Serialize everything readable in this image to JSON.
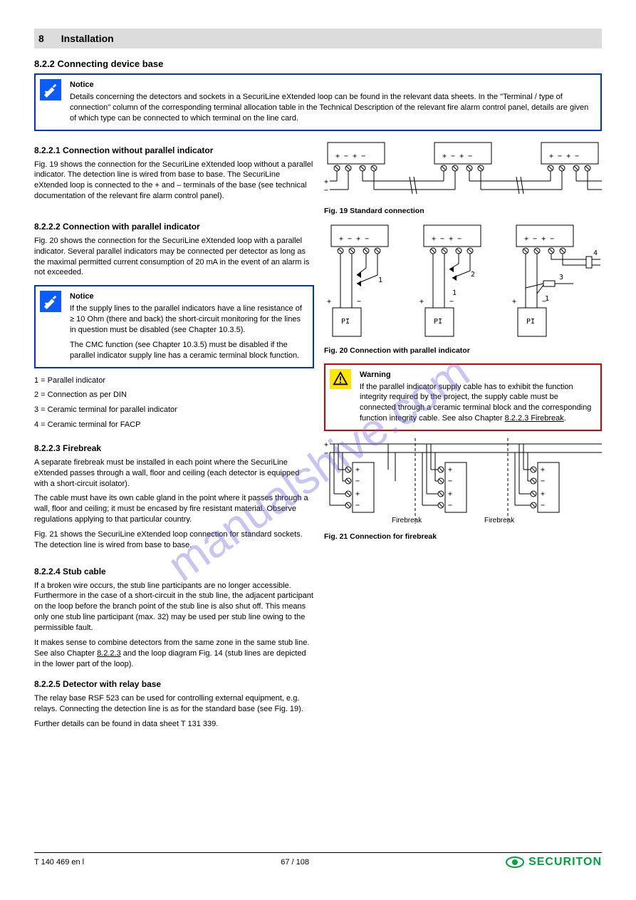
{
  "header": {
    "section_number": "8",
    "section_title": "Installation"
  },
  "section_top": "8.2.2   Connecting device base",
  "top_note": {
    "title": "Notice",
    "body": "Details concerning the detectors and sockets in a SecuriLine eXtended loop can be found in the relevant data sheets. In the \"Terminal / type of connection\" column of the corresponding terminal allocation table in the Technical Description of the relevant fire alarm control panel, details are given of which type can be connected to which terminal on the line card."
  },
  "conn_heading": "8.2.2.1  Connection without parallel indicator",
  "conn_para": "Fig. 19 shows the connection for the SecuriLine eXtended loop without a parallel indicator. The detection line is wired from base to base. The SecuriLine eXtended loop is connected to the + and – terminals of the base (see technical documentation of the relevant fire alarm control panel).",
  "fig19_caption": "Fig. 19  Standard connection",
  "parallel_heading": "8.2.2.2  Connection with parallel indicator",
  "parallel_para": "Fig. 20 shows the connection for the SecuriLine eXtended loop with a parallel indicator. Several parallel indicators may be connected per detector as long as the maximal permitted current consumption of 20 mA in the event of an alarm is not exceeded.",
  "small_note": {
    "title": "Notice",
    "body_lines": [
      "If the supply lines to the parallel indicators have a line resistance of ≥ 10 Ohm (there and back) the short-circuit monitoring for the lines in question must be disabled (see Chapter 10.3.5).",
      "The CMC function (see Chapter 10.3.5) must be disabled if the parallel indicator supply line has a ceramic terminal block function."
    ]
  },
  "fig20_legend_lines": [
    "1 = Parallel indicator",
    "2 = Connection as per DIN",
    "3 = Ceramic terminal for parallel indicator",
    "4 = Ceramic terminal for FACP"
  ],
  "fig20_caption": "Fig. 20  Connection with parallel indicator",
  "warning": {
    "title": "Warning",
    "body_prefix": "If the parallel indicator supply cable has to exhibit the function integrity required by the project, the supply cable must be connected through a ceramic terminal block and the corresponding function integrity cable. See also Chapter ",
    "body_link": "8.2.2.3 Firebreak",
    "body_suffix": "."
  },
  "firebreak_heading": "8.2.2.3  Firebreak",
  "firebreak_p1": "A separate firebreak must be installed in each point where the SecuriLine eXtended passes through a wall, floor and ceiling (each detector is equipped with a short-circuit isolator).",
  "firebreak_p2": "The cable must have its own cable gland in the point where it passes through a wall, floor and ceiling; it must be encased by fire resistant material. Observe regulations applying to that particular country.",
  "firebreak_p3": "Fig. 21 shows the SecuriLine eXtended loop connection for standard sockets. The detection line is wired from base to base.",
  "fig21_caption": "Fig. 21  Connection for firebreak",
  "stub_heading_1": "8.2.2.4  Stub cable",
  "stub_p1": "If a broken wire occurs, the stub line participants are no longer accessible. Furthermore in the case of a short-circuit in the stub line, the adjacent participant on the loop before the branch point of the stub line is also shut off. This means only one stub line participant (max. 32) may be used per stub line owing to the permissible fault.",
  "stub_p2_prefix": "It makes sense to combine detectors from the same zone in the same stub line. See also Chapter ",
  "stub_p2_link": "8.2.2.3",
  "stub_p2_suffix": " and the loop diagram Fig. 14 (stub lines are depicted in the lower part of the loop).",
  "stub_heading_2": "8.2.2.5  Detector with relay base",
  "relay_p1": "The relay base RSF 523 can be used for controlling external equipment, e.g. relays. Connecting the detection line is as for the standard base (see Fig. 19).",
  "relay_p2": "Further details can be found in data sheet T 131 339.",
  "pi_label": "PI",
  "fig21_firebreak_label": "Firebreak",
  "fig20_marker_1": "1",
  "fig20_marker_2": "2",
  "fig20_marker_3": "3",
  "fig20_marker_4": "4",
  "footer": {
    "left": "T 140 469 en l",
    "center": "67 / 108",
    "brand": "SECURITON"
  },
  "watermark": "manualshive.com"
}
